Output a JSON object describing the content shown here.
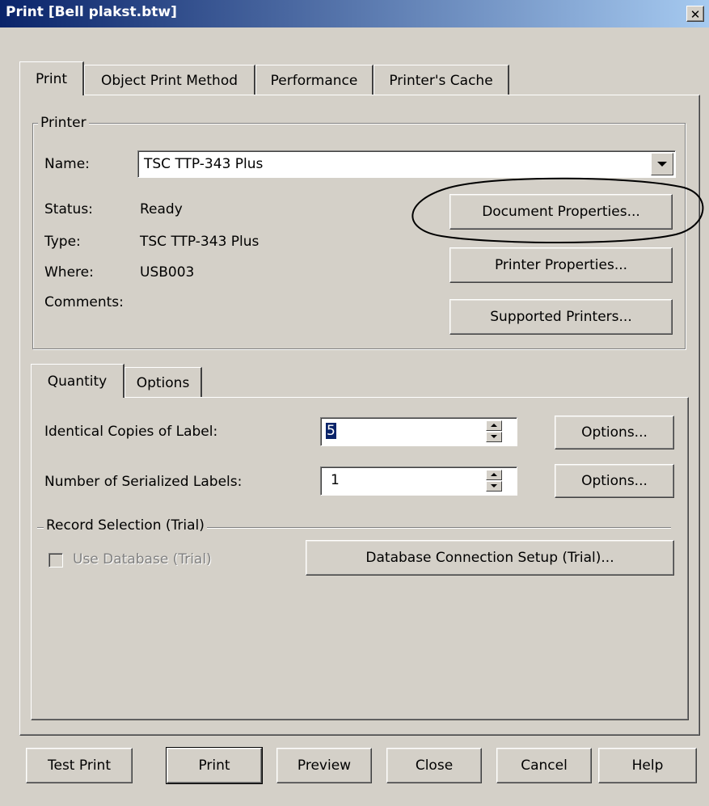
{
  "window": {
    "title": "Print [Bell plakst.btw]",
    "close_glyph": "✕"
  },
  "tabs": [
    "Print",
    "Object Print Method",
    "Performance",
    "Printer's Cache"
  ],
  "printer": {
    "group_label": "Printer",
    "name_label": "Name:",
    "name_value": "TSC TTP-343 Plus",
    "status_label": "Status:",
    "status_value": "Ready",
    "type_label": "Type:",
    "type_value": "TSC TTP-343 Plus",
    "where_label": "Where:",
    "where_value": "USB003",
    "comments_label": "Comments:",
    "document_properties": "Document Properties...",
    "printer_properties": "Printer Properties...",
    "supported_printers": "Supported Printers..."
  },
  "subtabs": [
    "Quantity",
    "Options"
  ],
  "quantity": {
    "identical_copies_label": "Identical Copies of Label:",
    "identical_copies_value": "5",
    "serialized_label": "Number of Serialized Labels:",
    "serialized_value": "1",
    "options1": "Options...",
    "options2": "Options...",
    "record_selection_label": "Record Selection  (Trial)",
    "use_database_label": "Use Database (Trial)",
    "db_setup": "Database Connection Setup (Trial)..."
  },
  "footer": {
    "test_print": "Test Print",
    "print": "Print",
    "preview": "Preview",
    "close": "Close",
    "cancel": "Cancel",
    "help": "Help"
  },
  "colors": {
    "face": "#d4d0c8",
    "title_start": "#0a246a",
    "title_end": "#a6caf0",
    "annotation": "#000000"
  },
  "icons": {
    "close": "close-icon",
    "dropdown": "chevron-down-icon",
    "spin_up": "spin-up-icon",
    "spin_down": "spin-down-icon"
  }
}
